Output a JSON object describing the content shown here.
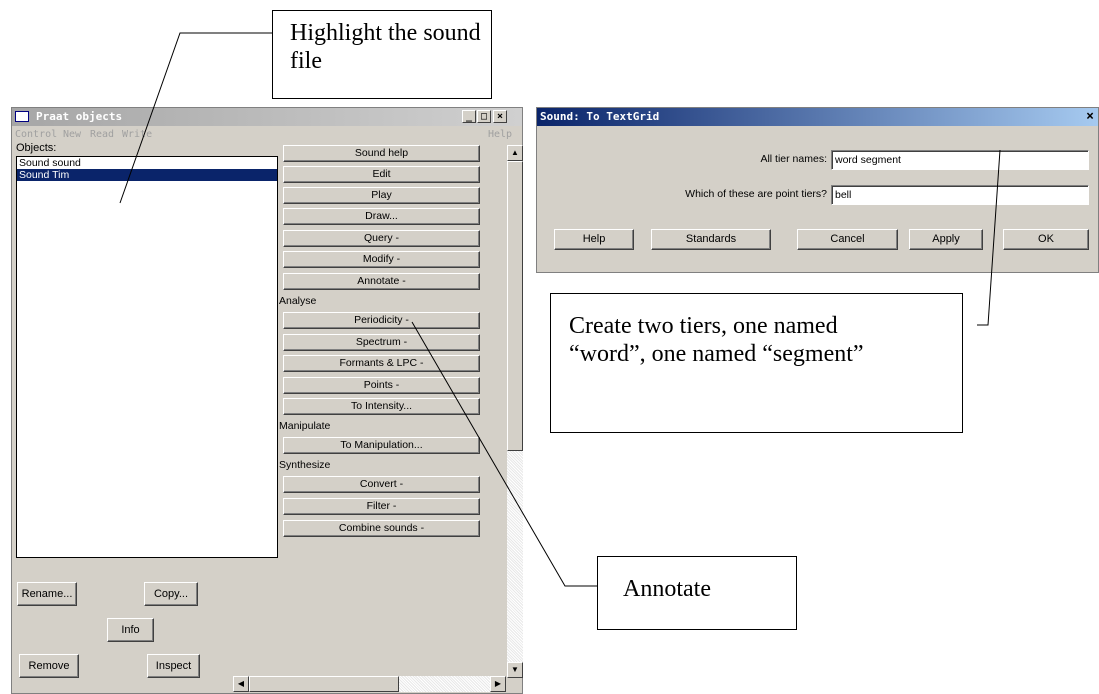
{
  "praat": {
    "title": "Praat objects",
    "menu": [
      "Control",
      "New",
      "Read",
      "Write"
    ],
    "help_menu": "Help",
    "objects_label": "Objects:",
    "objects": [
      "Sound sound",
      "Sound Tim"
    ],
    "selected_index": 1,
    "buttons": {
      "sound_help": "Sound help",
      "edit": "Edit",
      "play": "Play",
      "draw": "Draw...",
      "query": "Query -",
      "modify": "Modify -",
      "annotate": "Annotate -",
      "periodicity": "Periodicity -",
      "spectrum": "Spectrum -",
      "formants": "Formants & LPC -",
      "points": "Points -",
      "to_intensity": "To Intensity...",
      "to_manipulation": "To Manipulation...",
      "convert": "Convert -",
      "filter": "Filter -",
      "combine": "Combine sounds -"
    },
    "sections": {
      "analyse": "Analyse",
      "manipulate": "Manipulate",
      "synthesize": "Synthesize"
    },
    "bottom_buttons": {
      "rename": "Rename...",
      "copy": "Copy...",
      "info": "Info",
      "remove": "Remove",
      "inspect": "Inspect"
    }
  },
  "dialog": {
    "title": "Sound: To TextGrid",
    "all_tier_names_label": "All tier names:",
    "all_tier_names_value": "word segment",
    "point_tiers_label": "Which of these are point tiers?",
    "point_tiers_value": "bell",
    "buttons": {
      "help": "Help",
      "standards": "Standards",
      "cancel": "Cancel",
      "apply": "Apply",
      "ok": "OK"
    }
  },
  "callouts": {
    "highlight": "Highlight the sound file",
    "tiers": "Create two tiers, one named “word”, one named “segment”",
    "annotate": "Annotate"
  }
}
